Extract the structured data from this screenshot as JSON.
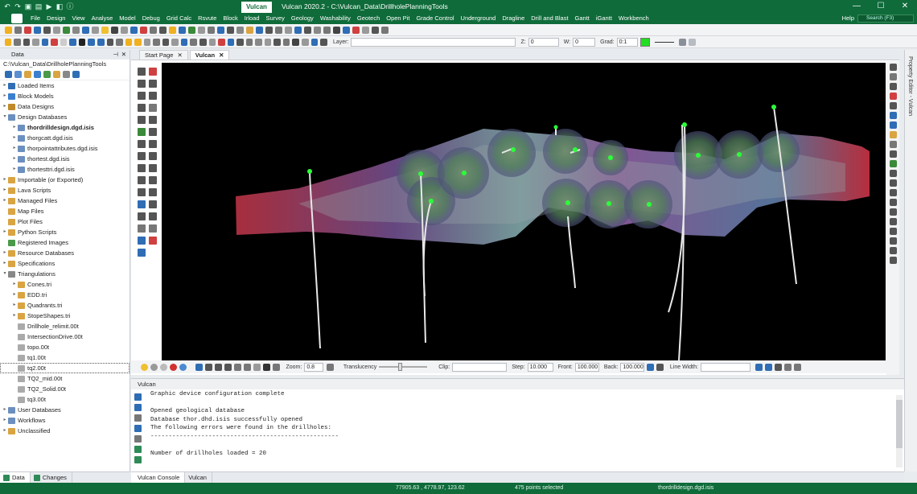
{
  "window": {
    "tab_label": "Vulcan",
    "title": "Vulcan 2020.2 - C:\\Vulcan_Data\\DrillholePlanningTools",
    "minimize": "—",
    "maximize": "☐",
    "close": "✕"
  },
  "menu": {
    "items": [
      "File",
      "Design",
      "View",
      "Analyse",
      "Model",
      "Debug",
      "Grid Calc",
      "Rsvute",
      "Block",
      "Irload",
      "Survey",
      "Geology",
      "Washability",
      "Geotech",
      "Open Pit",
      "Grade Control",
      "Underground",
      "Dragline",
      "Drill and Blast",
      "Gantt",
      "iGantt",
      "Workbench"
    ],
    "help": "Help",
    "search_placeholder": "Search (F3)"
  },
  "toolbar": {
    "layer_label": "Layer:",
    "z_label": "Z:",
    "z_value": "0",
    "w_label": "W:",
    "w_value": "0",
    "grad_label": "Grad:",
    "grad_value": "0:1",
    "grad_color": "#22dd22"
  },
  "data_panel": {
    "header": "Data",
    "path": "C:\\Vulcan_Data\\DrillholePlanningTools",
    "tree": [
      {
        "label": "Loaded Items",
        "depth": 0,
        "arrow": "▸",
        "icon": "#2f6db5"
      },
      {
        "label": "Block Models",
        "depth": 0,
        "arrow": "▸",
        "icon": "#3b7fd0"
      },
      {
        "label": "Data Designs",
        "depth": 0,
        "arrow": "▸",
        "icon": "#c08a2a"
      },
      {
        "label": "Design Databases",
        "depth": 0,
        "arrow": "▾",
        "icon": "#6b8fbf"
      },
      {
        "label": "thordrilldesign.dgd.isis",
        "depth": 1,
        "arrow": "▸",
        "icon": "#6b8fbf",
        "bold": true
      },
      {
        "label": "thorgcatt.dgd.isis",
        "depth": 1,
        "arrow": "▸",
        "icon": "#6b8fbf"
      },
      {
        "label": "thorpointattributes.dgd.isis",
        "depth": 1,
        "arrow": "▸",
        "icon": "#6b8fbf"
      },
      {
        "label": "thortest.dgd.isis",
        "depth": 1,
        "arrow": "▸",
        "icon": "#6b8fbf"
      },
      {
        "label": "thortesttri.dgd.isis",
        "depth": 1,
        "arrow": "▸",
        "icon": "#6b8fbf"
      },
      {
        "label": "Importable (or Exported)",
        "depth": 0,
        "arrow": "▸",
        "icon": "#d9a441"
      },
      {
        "label": "Lava Scripts",
        "depth": 0,
        "arrow": "▸",
        "icon": "#d9a441"
      },
      {
        "label": "Managed Files",
        "depth": 0,
        "arrow": "▸",
        "icon": "#d9a441"
      },
      {
        "label": "Map Files",
        "depth": 0,
        "arrow": "",
        "icon": "#d9a441"
      },
      {
        "label": "Plot Files",
        "depth": 0,
        "arrow": "",
        "icon": "#d9a441"
      },
      {
        "label": "Python Scripts",
        "depth": 0,
        "arrow": "▸",
        "icon": "#d9a441"
      },
      {
        "label": "Registered Images",
        "depth": 0,
        "arrow": "",
        "icon": "#4a9a4a"
      },
      {
        "label": "Resource Databases",
        "depth": 0,
        "arrow": "▸",
        "icon": "#d9a441"
      },
      {
        "label": "Specifications",
        "depth": 0,
        "arrow": "▸",
        "icon": "#d9a441"
      },
      {
        "label": "Triangulations",
        "depth": 0,
        "arrow": "▾",
        "icon": "#888888"
      },
      {
        "label": "Cones.tri",
        "depth": 1,
        "arrow": "▸",
        "icon": "#d9a441"
      },
      {
        "label": "EDD.tri",
        "depth": 1,
        "arrow": "▸",
        "icon": "#d9a441"
      },
      {
        "label": "Quadrants.tri",
        "depth": 1,
        "arrow": "▸",
        "icon": "#d9a441"
      },
      {
        "label": "StopeShapes.tri",
        "depth": 1,
        "arrow": "▸",
        "icon": "#d9a441"
      },
      {
        "label": "Drillhole_relimit.00t",
        "depth": 1,
        "arrow": "",
        "icon": "#aaaaaa"
      },
      {
        "label": "IntersectionDrive.00t",
        "depth": 1,
        "arrow": "",
        "icon": "#aaaaaa"
      },
      {
        "label": "topo.00t",
        "depth": 1,
        "arrow": "",
        "icon": "#aaaaaa"
      },
      {
        "label": "tq1.00t",
        "depth": 1,
        "arrow": "",
        "icon": "#aaaaaa"
      },
      {
        "label": "tq2.00t",
        "depth": 1,
        "arrow": "",
        "icon": "#aaaaaa",
        "selected": true
      },
      {
        "label": "TQ2_mid.00t",
        "depth": 1,
        "arrow": "",
        "icon": "#aaaaaa"
      },
      {
        "label": "TQ2_Solid.00t",
        "depth": 1,
        "arrow": "",
        "icon": "#aaaaaa"
      },
      {
        "label": "tq3.00t",
        "depth": 1,
        "arrow": "",
        "icon": "#aaaaaa"
      },
      {
        "label": "User Databases",
        "depth": 0,
        "arrow": "▸",
        "icon": "#6b8fbf"
      },
      {
        "label": "Workflows",
        "depth": 0,
        "arrow": "▸",
        "icon": "#6b8fbf"
      },
      {
        "label": "Unclassified",
        "depth": 0,
        "arrow": "▸",
        "icon": "#d9a441"
      }
    ]
  },
  "bottom_tabs_left": [
    "Data",
    "Changes"
  ],
  "doc_tabs": [
    "Start Page",
    "Vulcan"
  ],
  "view_toolbar": {
    "zoom_label": "Zoom:",
    "zoom_value": "0.8",
    "translucency_label": "Translucency",
    "clip_label": "Clip:",
    "step_label": "Step:",
    "step_value": "10.000",
    "front_label": "Front:",
    "front_value": "100.000",
    "back_label": "Back:",
    "back_value": "100.000",
    "line_width_label": "Line Width:"
  },
  "console": {
    "header": "Vulcan",
    "lines": [
      "Graphic device configuration complete",
      "",
      "Opened geological database",
      "Database thor.dhd.isis successfully opened",
      "The following errors were found in the drillholes:",
      "----------------------------------------------------",
      "",
      "Number of drillholes loaded = 20"
    ]
  },
  "bottom_tabs_right": [
    "Vulcan Console",
    "Vulcan"
  ],
  "property_editor_label": "Property Editor - Vulcan",
  "status": {
    "coords": "77905.63 , 4778.97, 123.62",
    "points": "475 points selected",
    "file": "thordrilldesign.dgd.isis"
  }
}
